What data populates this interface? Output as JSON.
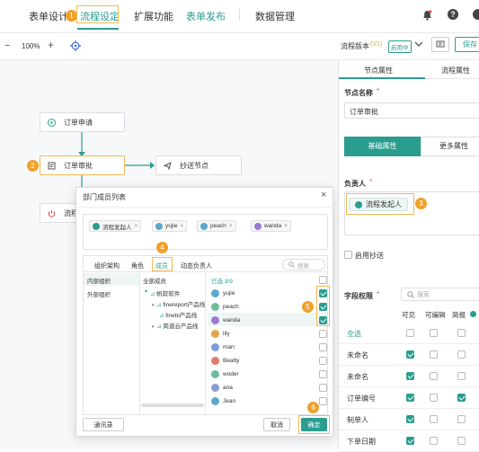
{
  "nav": {
    "items": [
      "表单设计",
      "流程设定",
      "扩展功能",
      "表单发布",
      "数据管理"
    ],
    "active_index": 1,
    "badge_1": "1"
  },
  "toolbar": {
    "zoom": "100%",
    "version_label": "流程版本",
    "version_tag": "(V1)",
    "version_status": "启用中",
    "save_label": "保存"
  },
  "flow": {
    "nodes": [
      "订单申请",
      "订单审批",
      "抄送节点",
      "流程"
    ],
    "badge_2": "2"
  },
  "right_panel": {
    "tabs": [
      "节点属性",
      "流程属性"
    ],
    "node_name_label": "节点名称",
    "node_name_value": "订单审批",
    "basic_tab": "基础属性",
    "more_tab": "更多属性",
    "owner_label": "负责人",
    "owner_chip": "流程发起人",
    "badge_3": "3",
    "cc_label": "启用抄送",
    "field_perm_label": "字段权限",
    "search_placeholder": "搜索",
    "cols": [
      "可见",
      "可编辑",
      "简报"
    ],
    "rows": [
      {
        "label": "全选",
        "v": false,
        "e": false,
        "s": false,
        "blue": true
      },
      {
        "label": "未命名",
        "v": true,
        "e": false,
        "s": false
      },
      {
        "label": "未命名",
        "v": true,
        "e": false,
        "s": false
      },
      {
        "label": "订单编号",
        "v": true,
        "e": false,
        "s": true
      },
      {
        "label": "制单人",
        "v": true,
        "e": false,
        "s": false
      },
      {
        "label": "下单日期",
        "v": true,
        "e": false,
        "s": false
      }
    ]
  },
  "dialog": {
    "title": "部门成员列表",
    "chips": [
      {
        "label": "流程发起人",
        "color": "#2a9d8f"
      },
      {
        "label": "yujie",
        "color": "#5aa9c9"
      },
      {
        "label": "peach",
        "color": "#5aa9c9"
      },
      {
        "label": "wanda",
        "color": "#9b7ad3"
      }
    ],
    "tabs": [
      "组织架构",
      "角色",
      "成员",
      "动态负责人"
    ],
    "active_tab": 2,
    "badge_4": "4",
    "search_placeholder": "搜索",
    "left_groups": [
      "内部组织",
      "外部组织"
    ],
    "tree_header": "全部成员",
    "tree": [
      "帆软软件",
      "finereport产品线",
      "finebi产品线",
      "简道云产品线"
    ],
    "selected_count": "已选 3/9",
    "members": [
      {
        "name": "yujie",
        "checked": true
      },
      {
        "name": "peach",
        "checked": true
      },
      {
        "name": "wanda",
        "checked": true
      },
      {
        "name": "lily",
        "checked": false
      },
      {
        "name": "marr",
        "checked": false
      },
      {
        "name": "Beatty",
        "checked": false
      },
      {
        "name": "woder",
        "checked": false
      },
      {
        "name": "ana",
        "checked": false
      },
      {
        "name": "Jean",
        "checked": false
      }
    ],
    "badge_5": "5",
    "badge_6": "6",
    "contacts_button": "通讯录",
    "cancel_button": "取消",
    "ok_button": "确定"
  },
  "colors": {
    "accent": "#2a9d8f",
    "highlight": "#f0b955",
    "badge": "#f0a02a"
  }
}
